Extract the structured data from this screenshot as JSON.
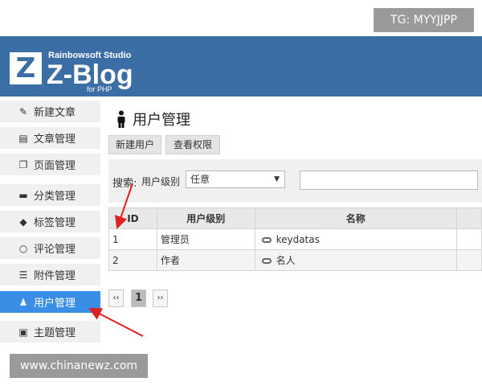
{
  "watermark_top": "TG: MYYJJPP",
  "watermark_bottom": "www.chinanewz.com",
  "header": {
    "logo_letter": "Z",
    "brand_studio": "Rainbowsoft Studio",
    "brand_main": "Z-Blog",
    "brand_sub": "for PHP",
    "background": "#3a6ea5"
  },
  "sidebar": {
    "items": [
      {
        "label": "新建文章",
        "icon": "edit-icon"
      },
      {
        "label": "文章管理",
        "icon": "document-icon"
      },
      {
        "label": "页面管理",
        "icon": "pages-icon"
      },
      {
        "label": "分类管理",
        "icon": "folder-icon"
      },
      {
        "label": "标签管理",
        "icon": "tag-icon"
      },
      {
        "label": "评论管理",
        "icon": "comment-icon"
      },
      {
        "label": "附件管理",
        "icon": "attachment-icon"
      },
      {
        "label": "用户管理",
        "icon": "user-icon",
        "active": true
      },
      {
        "label": "主题管理",
        "icon": "theme-icon"
      }
    ],
    "active_color": "#3a8ee6"
  },
  "main": {
    "title": "用户管理",
    "buttons": {
      "new_user": "新建用户",
      "view_permissions": "查看权限"
    },
    "search": {
      "label": "搜索:",
      "level_label": "用户级别",
      "level_value": "任意"
    },
    "table": {
      "headers": [
        "ID",
        "用户级别",
        "名称"
      ],
      "rows": [
        {
          "id": "1",
          "level": "管理员",
          "name": "keydatas"
        },
        {
          "id": "2",
          "level": "作者",
          "name": "名人"
        }
      ]
    },
    "pagination": {
      "first": "‹‹",
      "current": "1",
      "last": "››"
    }
  }
}
